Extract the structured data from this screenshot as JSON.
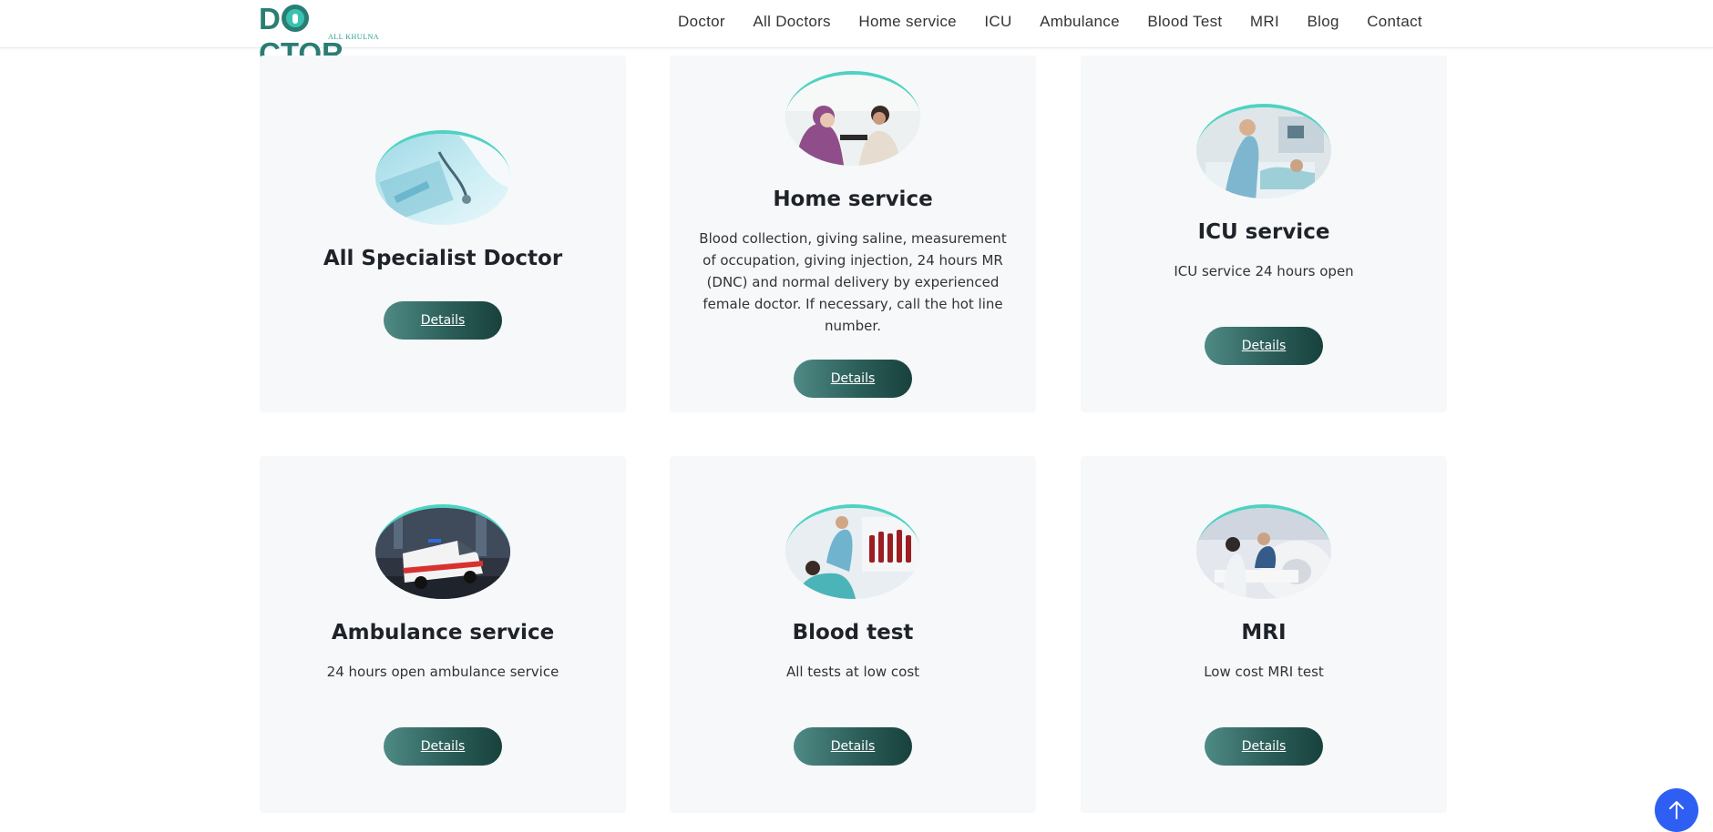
{
  "brand": {
    "logo_text_1": "D",
    "logo_text_2": "CTOR",
    "logo_sub": "ALL KHULNA"
  },
  "nav": [
    "Doctor",
    "All Doctors",
    "Home service",
    "ICU",
    "Ambulance",
    "Blood Test",
    "MRI",
    "Blog",
    "Contact"
  ],
  "cards": [
    {
      "title": "All Specialist Doctor",
      "desc": "",
      "button": "Details",
      "image": "doctor-stethoscope-image"
    },
    {
      "title": "Home service",
      "desc": "Blood collection, giving saline, measurement of occupation, giving injection, 24 hours MR (DNC) and normal delivery by experienced female doctor. If necessary, call the hot line number.",
      "button": "Details",
      "image": "home-visit-image"
    },
    {
      "title": "ICU service",
      "desc": "ICU service 24 hours open",
      "button": "Details",
      "image": "icu-nurse-image"
    },
    {
      "title": "Ambulance service",
      "desc": "24 hours open ambulance  service",
      "button": "Details",
      "image": "ambulance-image"
    },
    {
      "title": "Blood test",
      "desc": "All tests at low cost",
      "button": "Details",
      "image": "blood-sample-image"
    },
    {
      "title": "MRI",
      "desc": "Low cost MRI test",
      "button": "Details",
      "image": "mri-scanner-image"
    }
  ],
  "scroll_top": {
    "icon": "arrow-up-icon",
    "color": "#2f5ff2"
  },
  "colors": {
    "accent": "#2a7d72",
    "button_dark": "#18413c",
    "button_light": "#4f8a85",
    "card_bg": "#f6f8fa"
  }
}
